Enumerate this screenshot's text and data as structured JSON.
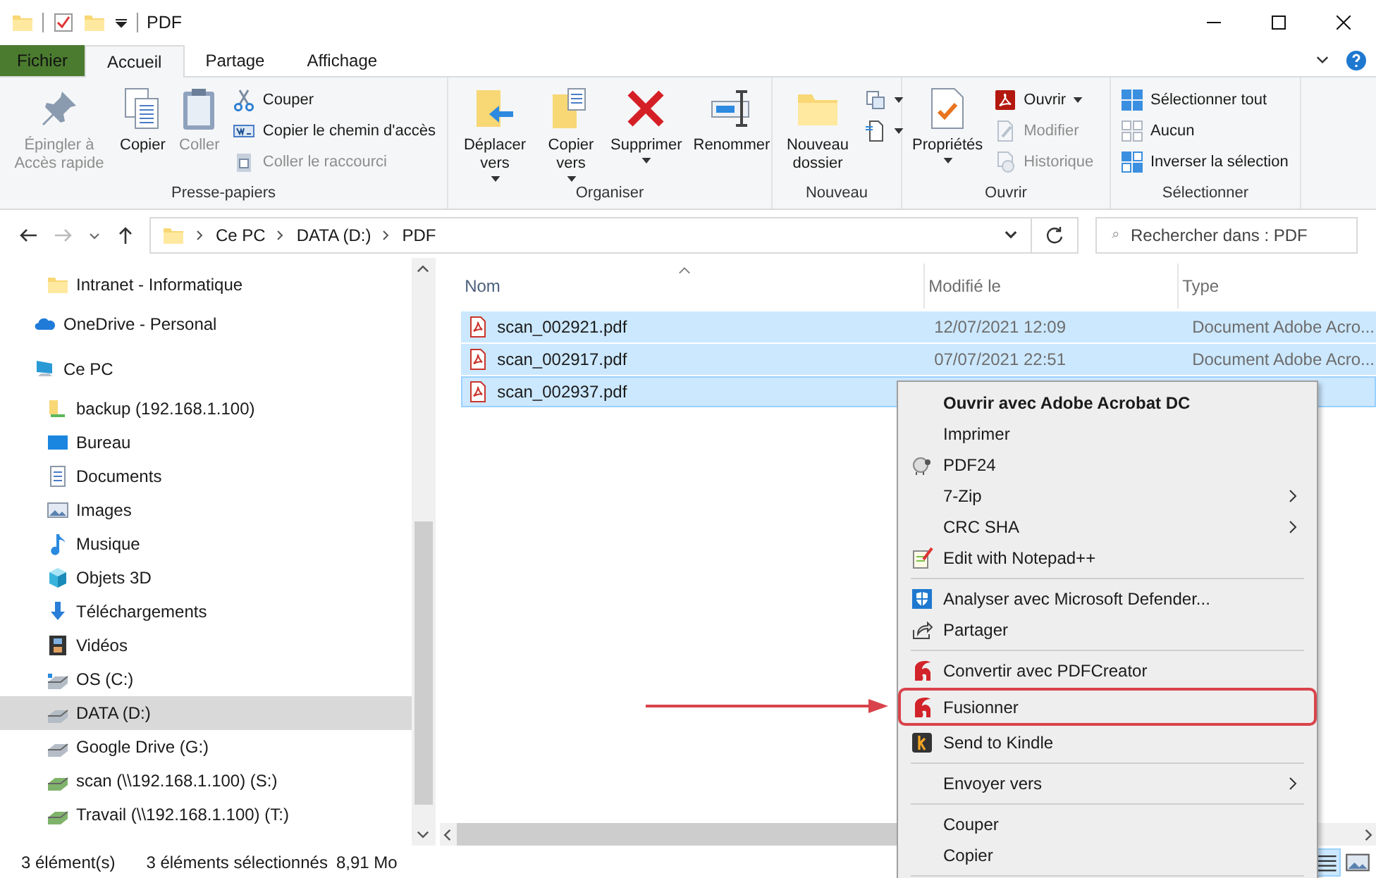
{
  "window": {
    "title": "PDF"
  },
  "ribbon": {
    "tabs": [
      {
        "label": "Fichier",
        "kind": "file",
        "selected": false
      },
      {
        "label": "Accueil",
        "kind": "tab",
        "selected": true
      },
      {
        "label": "Partage",
        "kind": "tab",
        "selected": false
      },
      {
        "label": "Affichage",
        "kind": "tab",
        "selected": false
      }
    ],
    "groups": [
      {
        "label": "Presse-papiers",
        "buttons": [
          {
            "label": "Épingler à Accès rapide",
            "kind": "large",
            "disabled": true,
            "dropdown": false
          },
          {
            "label": "Copier",
            "kind": "large",
            "disabled": false,
            "dropdown": false
          },
          {
            "label": "Coller",
            "kind": "large",
            "disabled": true,
            "dropdown": false
          },
          {
            "label": "Couper",
            "kind": "small",
            "disabled": false,
            "dropdown": false
          },
          {
            "label": "Copier le chemin d'accès",
            "kind": "small",
            "disabled": false,
            "dropdown": false
          },
          {
            "label": "Coller le raccourci",
            "kind": "small",
            "disabled": true,
            "dropdown": false
          }
        ]
      },
      {
        "label": "Organiser",
        "buttons": [
          {
            "label": "Déplacer vers",
            "kind": "large",
            "disabled": false,
            "dropdown": true
          },
          {
            "label": "Copier vers",
            "kind": "large",
            "disabled": false,
            "dropdown": true
          },
          {
            "label": "Supprimer",
            "kind": "large",
            "disabled": false,
            "dropdown": true
          },
          {
            "label": "Renommer",
            "kind": "large",
            "disabled": false,
            "dropdown": false
          }
        ]
      },
      {
        "label": "Nouveau",
        "buttons": [
          {
            "label": "Nouveau dossier",
            "kind": "large",
            "disabled": false,
            "dropdown": false
          },
          {
            "kind": "icon",
            "disabled": false,
            "dropdown": true
          },
          {
            "kind": "icon",
            "disabled": false,
            "dropdown": true
          }
        ]
      },
      {
        "label": "Ouvrir",
        "buttons": [
          {
            "label": "Propriétés",
            "kind": "large",
            "disabled": false,
            "dropdown": true
          },
          {
            "label": "Ouvrir",
            "kind": "small",
            "disabled": false,
            "dropdown": true
          },
          {
            "label": "Modifier",
            "kind": "small",
            "disabled": true,
            "dropdown": false
          },
          {
            "label": "Historique",
            "kind": "small",
            "disabled": true,
            "dropdown": false
          }
        ]
      },
      {
        "label": "Sélectionner",
        "buttons": [
          {
            "label": "Sélectionner tout",
            "kind": "small",
            "disabled": false,
            "dropdown": false
          },
          {
            "label": "Aucun",
            "kind": "small",
            "disabled": false,
            "dropdown": false
          },
          {
            "label": "Inverser la sélection",
            "kind": "small",
            "disabled": false,
            "dropdown": false
          }
        ]
      }
    ]
  },
  "address_bar": {
    "path": [
      "Ce PC",
      "DATA (D:)",
      "PDF"
    ]
  },
  "search": {
    "placeholder": "Rechercher dans : PDF"
  },
  "navigation": {
    "quick_access_items": [
      {
        "label": "Intranet - Informatique",
        "selected": false
      }
    ],
    "items": [
      {
        "label": "OneDrive - Personal",
        "selected": false
      },
      {
        "label": "Ce PC",
        "selected": false,
        "children": [
          {
            "label": "backup (192.168.1.100)",
            "selected": false
          },
          {
            "label": "Bureau",
            "selected": false
          },
          {
            "label": "Documents",
            "selected": false
          },
          {
            "label": "Images",
            "selected": false
          },
          {
            "label": "Musique",
            "selected": false
          },
          {
            "label": "Objets 3D",
            "selected": false
          },
          {
            "label": "Téléchargements",
            "selected": false
          },
          {
            "label": "Vidéos",
            "selected": false
          },
          {
            "label": "OS (C:)",
            "selected": false
          },
          {
            "label": "DATA (D:)",
            "selected": true
          },
          {
            "label": "Google Drive (G:)",
            "selected": false
          },
          {
            "label": "scan (\\\\192.168.1.100) (S:)",
            "selected": false
          },
          {
            "label": "Travail (\\\\192.168.1.100) (T:)",
            "selected": false
          }
        ]
      }
    ]
  },
  "table": {
    "columns": [
      "Nom",
      "Modifié le",
      "Type"
    ],
    "rows": [
      {
        "name": "scan_002921.pdf",
        "modified": "12/07/2021 12:09",
        "type": "Document Adobe Acro...",
        "selected": true
      },
      {
        "name": "scan_002917.pdf",
        "modified": "07/07/2021 22:51",
        "type": "Document Adobe Acro...",
        "selected": true
      },
      {
        "name": "scan_002937.pdf",
        "selected": true
      }
    ]
  },
  "context_menu": {
    "groups": [
      [
        {
          "label": "Ouvrir avec Adobe Acrobat DC",
          "bold": true,
          "submenu": false,
          "highlighted": false
        },
        {
          "label": "Imprimer",
          "bold": false,
          "submenu": false,
          "highlighted": false
        },
        {
          "label": "PDF24",
          "bold": false,
          "submenu": false,
          "highlighted": false
        },
        {
          "label": "7-Zip",
          "bold": false,
          "submenu": true,
          "highlighted": false
        },
        {
          "label": "CRC SHA",
          "bold": false,
          "submenu": true,
          "highlighted": false
        },
        {
          "label": "Edit with Notepad++",
          "bold": false,
          "submenu": false,
          "highlighted": false
        }
      ],
      [
        {
          "label": "Analyser avec Microsoft Defender...",
          "bold": false,
          "submenu": false,
          "highlighted": false
        },
        {
          "label": "Partager",
          "bold": false,
          "submenu": false,
          "highlighted": false
        }
      ],
      [
        {
          "label": "Convertir avec PDFCreator",
          "bold": false,
          "submenu": false,
          "highlighted": false
        },
        {
          "label": "Fusionner",
          "bold": false,
          "submenu": false,
          "highlighted": true
        },
        {
          "label": "Send to Kindle",
          "bold": false,
          "submenu": false,
          "highlighted": false
        }
      ],
      [
        {
          "label": "Envoyer vers",
          "bold": false,
          "submenu": true,
          "highlighted": false
        }
      ],
      [
        {
          "label": "Couper",
          "bold": false,
          "submenu": false,
          "highlighted": false
        },
        {
          "label": "Copier",
          "bold": false,
          "submenu": false,
          "highlighted": false
        }
      ]
    ]
  },
  "status_bar": {
    "item_count": "3 élément(s)",
    "selection": "3 éléments sélectionnés",
    "size": "8,91 Mo"
  }
}
